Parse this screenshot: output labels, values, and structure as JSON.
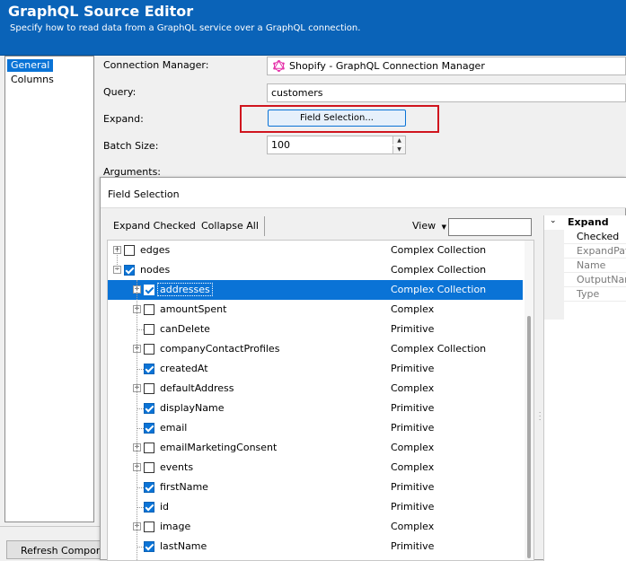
{
  "header": {
    "title": "GraphQL Source Editor",
    "subtitle": "Specify how to read data from a GraphQL service over a GraphQL connection."
  },
  "nav": {
    "items": [
      {
        "label": "General",
        "selected": true
      },
      {
        "label": "Columns",
        "selected": false
      }
    ]
  },
  "form": {
    "connection_manager_label": "Connection Manager:",
    "connection_manager_value": "Shopify - GraphQL Connection Manager",
    "query_label": "Query:",
    "query_value": "customers",
    "expand_label": "Expand:",
    "field_selection_button": "Field Selection...",
    "batch_size_label": "Batch Size:",
    "batch_size_value": "100",
    "arguments_label": "Arguments:"
  },
  "bottom": {
    "refresh_button": "Refresh Componen"
  },
  "dialog": {
    "title": "Field Selection",
    "toolbar": {
      "expand_checked": "Expand Checked",
      "collapse_all": "Collapse All",
      "view": "View",
      "view_value": ""
    },
    "tree": [
      {
        "name": "edges",
        "type": "Complex Collection",
        "level": 0,
        "expandable": true,
        "expanded": false,
        "checked": false,
        "selected": false
      },
      {
        "name": "nodes",
        "type": "Complex Collection",
        "level": 0,
        "expandable": true,
        "expanded": true,
        "checked": true,
        "selected": false
      },
      {
        "name": "addresses",
        "type": "Complex Collection",
        "level": 1,
        "expandable": true,
        "expanded": false,
        "checked": true,
        "selected": true
      },
      {
        "name": "amountSpent",
        "type": "Complex",
        "level": 1,
        "expandable": true,
        "expanded": false,
        "checked": false,
        "selected": false
      },
      {
        "name": "canDelete",
        "type": "Primitive",
        "level": 1,
        "expandable": false,
        "expanded": false,
        "checked": false,
        "selected": false
      },
      {
        "name": "companyContactProfiles",
        "type": "Complex Collection",
        "level": 1,
        "expandable": true,
        "expanded": false,
        "checked": false,
        "selected": false
      },
      {
        "name": "createdAt",
        "type": "Primitive",
        "level": 1,
        "expandable": false,
        "expanded": false,
        "checked": true,
        "selected": false
      },
      {
        "name": "defaultAddress",
        "type": "Complex",
        "level": 1,
        "expandable": true,
        "expanded": false,
        "checked": false,
        "selected": false
      },
      {
        "name": "displayName",
        "type": "Primitive",
        "level": 1,
        "expandable": false,
        "expanded": false,
        "checked": true,
        "selected": false
      },
      {
        "name": "email",
        "type": "Primitive",
        "level": 1,
        "expandable": false,
        "expanded": false,
        "checked": true,
        "selected": false
      },
      {
        "name": "emailMarketingConsent",
        "type": "Complex",
        "level": 1,
        "expandable": true,
        "expanded": false,
        "checked": false,
        "selected": false
      },
      {
        "name": "events",
        "type": "Complex",
        "level": 1,
        "expandable": true,
        "expanded": false,
        "checked": false,
        "selected": false
      },
      {
        "name": "firstName",
        "type": "Primitive",
        "level": 1,
        "expandable": false,
        "expanded": false,
        "checked": true,
        "selected": false
      },
      {
        "name": "id",
        "type": "Primitive",
        "level": 1,
        "expandable": false,
        "expanded": false,
        "checked": true,
        "selected": false
      },
      {
        "name": "image",
        "type": "Complex",
        "level": 1,
        "expandable": true,
        "expanded": false,
        "checked": false,
        "selected": false
      },
      {
        "name": "lastName",
        "type": "Primitive",
        "level": 1,
        "expandable": false,
        "expanded": false,
        "checked": true,
        "selected": false
      }
    ],
    "properties": {
      "category": "Expand",
      "rows": [
        {
          "label": "Checked",
          "dim": false
        },
        {
          "label": "ExpandPath",
          "dim": true
        },
        {
          "label": "Name",
          "dim": true
        },
        {
          "label": "OutputName",
          "dim": true
        },
        {
          "label": "Type",
          "dim": true
        }
      ]
    }
  },
  "colors": {
    "header_bg": "#0a63b8",
    "selection": "#0a73d6",
    "highlight": "#d0151e",
    "graphql_pink": "#e535ab"
  }
}
